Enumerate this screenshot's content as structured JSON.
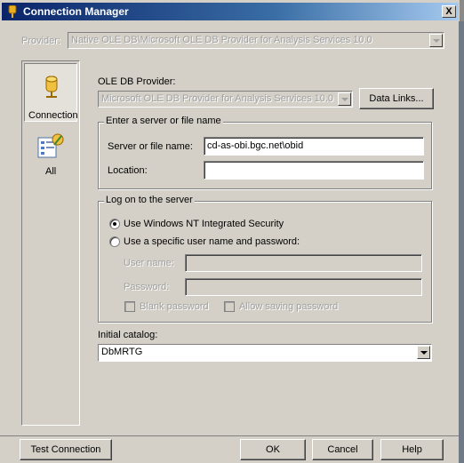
{
  "window": {
    "title": "Connection Manager",
    "close_label": "X"
  },
  "provider": {
    "label": "Provider:",
    "value": "Native OLE DB\\Microsoft OLE DB Provider for Analysis Services 10.0"
  },
  "sidebar": {
    "items": [
      {
        "label": "Connection"
      },
      {
        "label": "All"
      }
    ]
  },
  "oledb": {
    "label": "OLE DB Provider:",
    "value": "Microsoft OLE DB Provider for Analysis Services 10.0",
    "data_links_label": "Data Links..."
  },
  "server_group": {
    "legend": "Enter a server or file name",
    "server_label": "Server or file name:",
    "server_value": "cd-as-obi.bgc.net\\obid",
    "location_label": "Location:",
    "location_value": ""
  },
  "logon_group": {
    "legend": "Log on to the server",
    "option_windows": "Use Windows NT Integrated Security",
    "option_specific": "Use a specific user name and password:",
    "user_label": "User name:",
    "password_label": "Password:",
    "blank_password": "Blank password",
    "allow_saving": "Allow saving password"
  },
  "catalog": {
    "label": "Initial catalog:",
    "value": "DbMRTG"
  },
  "buttons": {
    "test": "Test Connection",
    "ok": "OK",
    "cancel": "Cancel",
    "help": "Help"
  }
}
